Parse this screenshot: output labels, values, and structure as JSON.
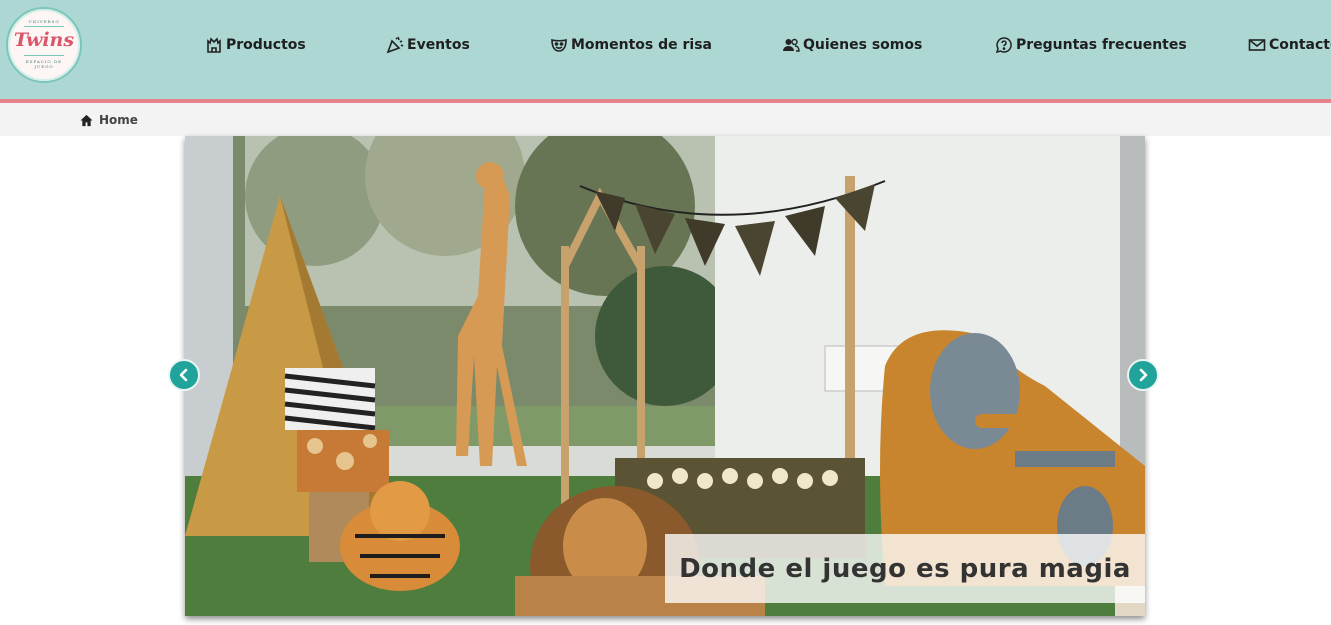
{
  "logo": {
    "top_text": "UNIVERSO",
    "brand": "Twins",
    "bottom_text_1": "ESPACIO DE",
    "bottom_text_2": "JUEGO"
  },
  "nav": {
    "items": [
      {
        "label": "Productos",
        "icon": "castle-icon"
      },
      {
        "label": "Eventos",
        "icon": "party-popper-icon"
      },
      {
        "label": "Momentos de risa",
        "icon": "mask-icon"
      },
      {
        "label": "Quienes somos",
        "icon": "users-icon"
      },
      {
        "label": "Preguntas frecuentes",
        "icon": "question-bubble-icon"
      },
      {
        "label": "Contacto",
        "icon": "envelope-icon"
      }
    ]
  },
  "breadcrumb": {
    "home_label": "Home",
    "icon": "home-icon"
  },
  "carousel": {
    "caption": "Donde el juego es pura magia",
    "prev_icon": "chevron-left-icon",
    "next_icon": "chevron-right-icon"
  },
  "colors": {
    "header_bg": "#acd7d2",
    "header_border": "#e4838c",
    "accent": "#20a39a",
    "brand_pink": "#d9566b"
  }
}
